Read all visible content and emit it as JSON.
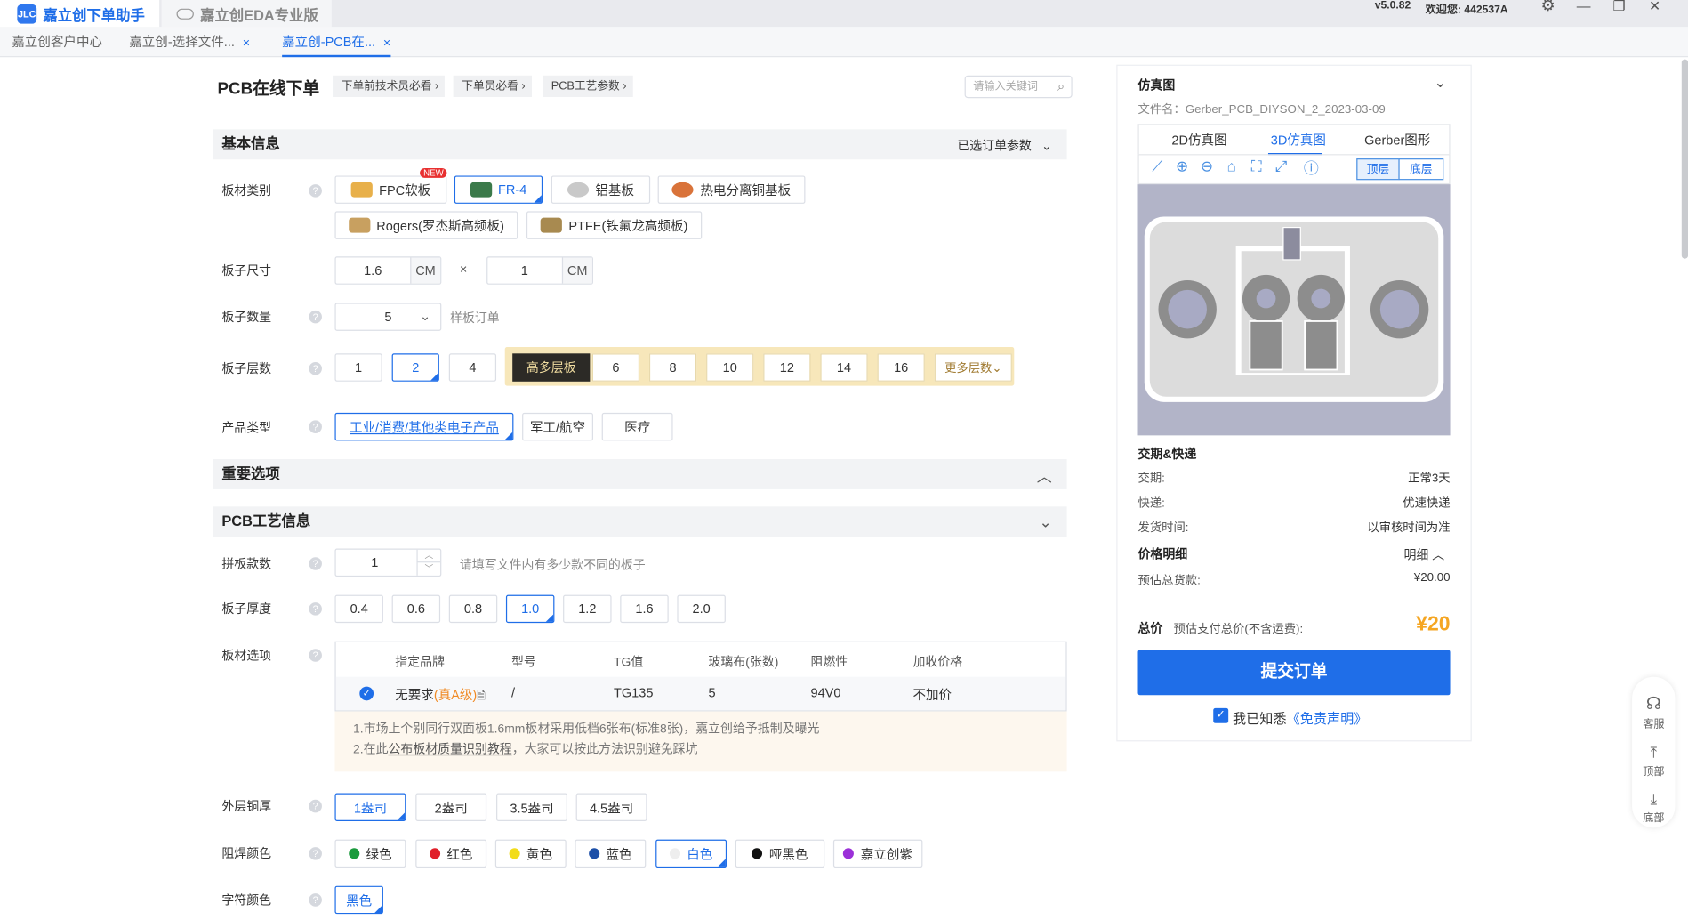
{
  "app_tabs": {
    "active": "嘉立创下单助手",
    "inactive": "嘉立创EDA专业版",
    "logo_text": "JLC"
  },
  "version": "v5.0.82",
  "welcome": "欢迎您: 442537A",
  "sub_tabs": [
    {
      "label": "嘉立创客户中心"
    },
    {
      "label": "嘉立创-选择文件..."
    },
    {
      "label": "嘉立创-PCB在..."
    }
  ],
  "page_title": "PCB在线下单",
  "crumbs": [
    "下单前技术员必看",
    "下单员必看",
    "PCB工艺参数"
  ],
  "search_placeholder": "请输入关键词",
  "sections": {
    "basic": "基本信息",
    "basic_right": "已选订单参数",
    "important": "重要选项",
    "process": "PCB工艺信息"
  },
  "labels": {
    "material": "板材类别",
    "size": "板子尺寸",
    "qty": "板子数量",
    "layers": "板子层数",
    "product": "产品类型",
    "panel": "拼板款数",
    "thickness": "板子厚度",
    "board_opt": "板材选项",
    "copper": "外层铜厚",
    "mask": "阻焊颜色",
    "silk": "字符颜色"
  },
  "materials": [
    {
      "label": "FPC软板",
      "badge": "NEW",
      "color": "#e8b04a"
    },
    {
      "label": "FR-4",
      "color": "#3b7a4a"
    },
    {
      "label": "铝基板",
      "color": "#c9c9c9"
    },
    {
      "label": "热电分离铜基板",
      "color": "#d9733a"
    },
    {
      "label": "Rogers(罗杰斯高频板)",
      "color": "#c8a060"
    },
    {
      "label": "PTFE(铁氟龙高频板)",
      "color": "#a88a50"
    }
  ],
  "size": {
    "w": "1.6",
    "h": "1",
    "unit": "CM",
    "x": "×"
  },
  "qty": {
    "value": "5",
    "note": "样板订单"
  },
  "layers": {
    "basic": [
      "1",
      "2",
      "4"
    ],
    "high_label": "高多层板",
    "high": [
      "6",
      "8",
      "10",
      "12",
      "14",
      "16"
    ],
    "more": "更多层数"
  },
  "product_types": [
    "工业/消费/其他类电子产品",
    "军工/航空",
    "医疗"
  ],
  "panel": {
    "value": "1",
    "hint": "请填写文件内有多少款不同的板子"
  },
  "thickness": [
    "0.4",
    "0.6",
    "0.8",
    "1.0",
    "1.2",
    "1.6",
    "2.0"
  ],
  "board_table": {
    "headers": [
      "指定品牌",
      "型号",
      "TG值",
      "玻璃布(张数)",
      "阻燃性",
      "加收价格"
    ],
    "row": {
      "brand": "无要求",
      "grade": "(真A级)",
      "model": "/",
      "tg": "TG135",
      "glass": "5",
      "flame": "94V0",
      "price": "不加价"
    }
  },
  "notes": {
    "line1": "1.市场上个别同行双面板1.6mm板材采用低档6张布(标准8张)，嘉立创给予抵制及曝光",
    "line2a": "2.在此",
    "line2link": "公布板材质量识别教程",
    "line2b": "，大家可以按此方法识别避免踩坑"
  },
  "copper": [
    "1盎司",
    "2盎司",
    "3.5盎司",
    "4.5盎司"
  ],
  "mask_colors": [
    {
      "label": "绿色",
      "color": "#1a9a3c"
    },
    {
      "label": "红色",
      "color": "#e0202a"
    },
    {
      "label": "黄色",
      "color": "#f2dc1a"
    },
    {
      "label": "蓝色",
      "color": "#1c4fa8"
    },
    {
      "label": "白色",
      "color": "#eeeeee"
    },
    {
      "label": "哑黑色",
      "color": "#111111"
    },
    {
      "label": "嘉立创紫",
      "color": "#9b30d8"
    }
  ],
  "silk": "黑色",
  "preview": {
    "title": "仿真图",
    "filename": "文件名：Gerber_PCB_DIYSON_2_2023-03-09",
    "tabs": [
      "2D仿真图",
      "3D仿真图",
      "Gerber图形"
    ],
    "layer_top": "顶层",
    "layer_bottom": "底层"
  },
  "delivery": {
    "title": "交期&快递",
    "rows": [
      {
        "k": "交期:",
        "v": "正常3天"
      },
      {
        "k": "快递:",
        "v": "优速快递"
      },
      {
        "k": "发货时间:",
        "v": "以审核时间为准"
      }
    ]
  },
  "price": {
    "title": "价格明细",
    "detail": "明细",
    "est_label": "预估总货款:",
    "est_value": "¥20.00",
    "total_label": "总价",
    "total_sub": "预估支付总价(不含运费):",
    "total_value": "¥20"
  },
  "submit": "提交订单",
  "agree": {
    "text": "我已知悉",
    "link": "《免责声明》"
  },
  "side": {
    "service": "客服",
    "top": "顶部",
    "bottom": "底部"
  },
  "colors": {
    "accent": "#1f6ee8",
    "price": "#f5a623",
    "gold": "#f7e7ba"
  }
}
